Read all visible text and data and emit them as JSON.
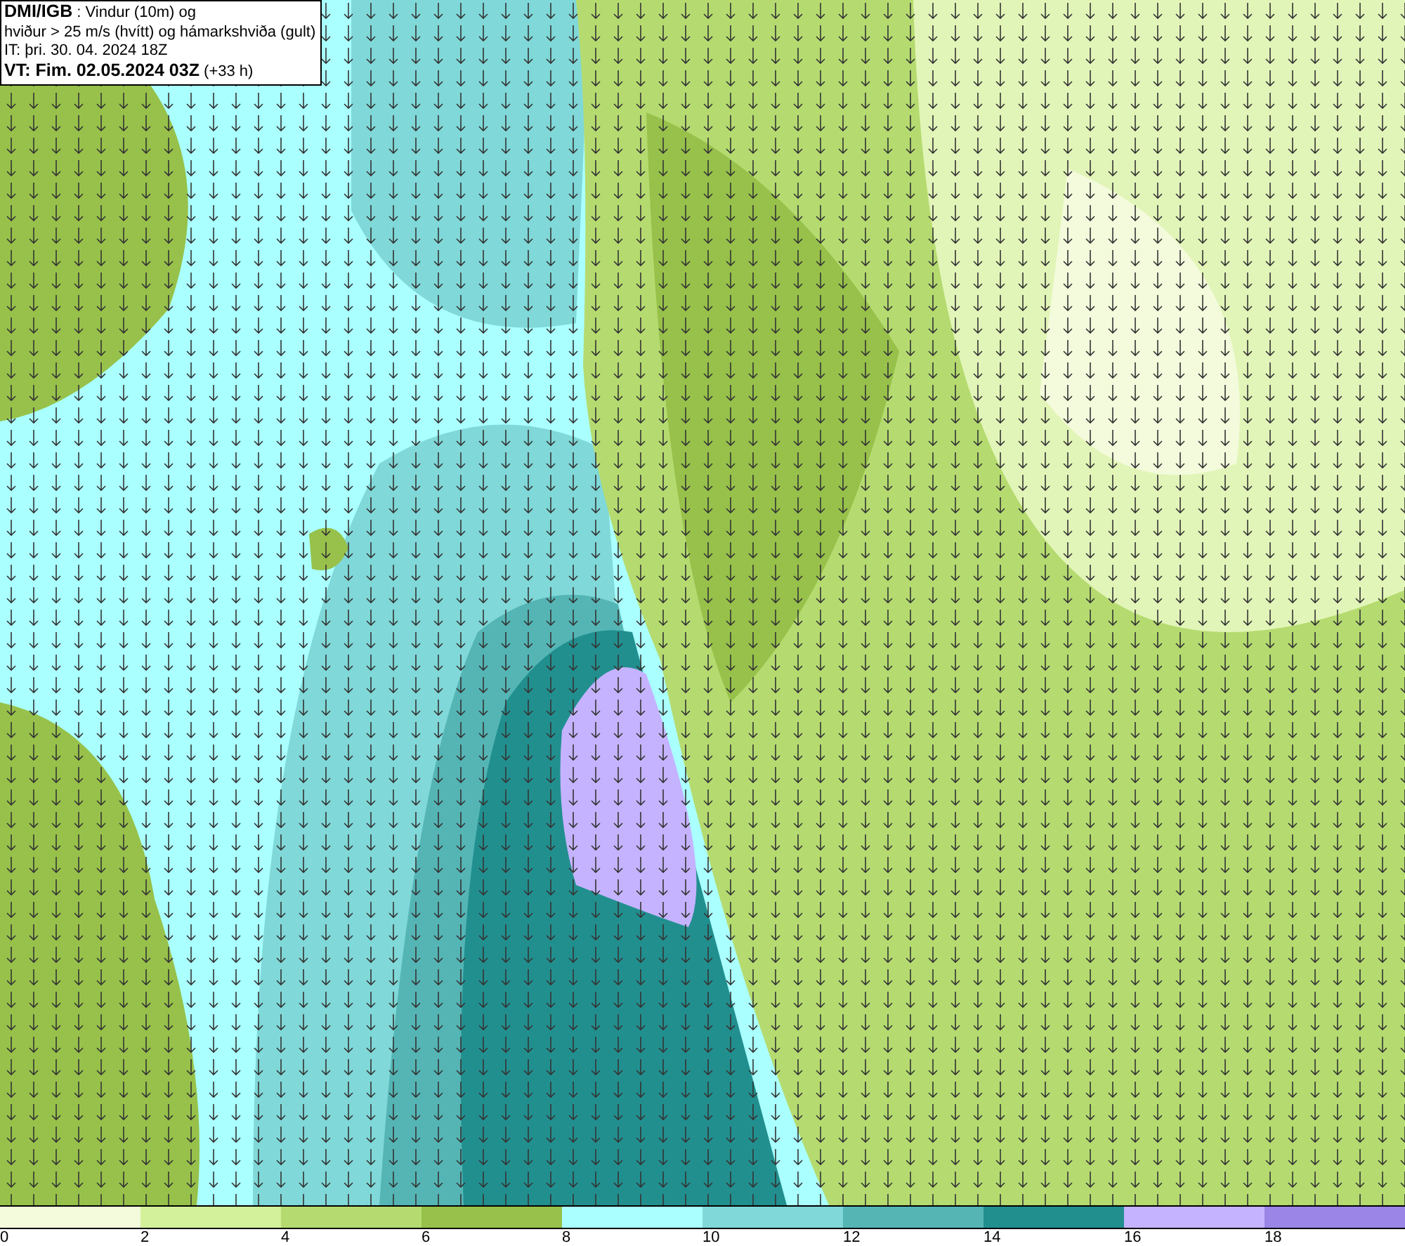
{
  "title_box": {
    "lines": [
      "**DMI/IGB** : Vindur (10m) og",
      "hviður > 25 m/s (hvítt) og hámarkshviða (gult)",
      "IT: þri. 30. 04. 2024 18Z",
      "**VT: Fim. 02.05.2024 03Z** (+33 h)"
    ]
  },
  "legend": {
    "segments": [
      {
        "color": "#f3fbdc"
      },
      {
        "color": "#d3f09a"
      },
      {
        "color": "#b5db70"
      },
      {
        "color": "#97c14a"
      },
      {
        "color": "#aaffff"
      },
      {
        "color": "#80d8d8"
      },
      {
        "color": "#55b5b5"
      },
      {
        "color": "#228f8f"
      },
      {
        "color": "#c5b3ff"
      },
      {
        "color": "#9b85e6"
      }
    ],
    "labels": [
      "0",
      "2",
      "4",
      "6",
      "8",
      "10",
      "12",
      "14",
      "16",
      "18"
    ]
  }
}
